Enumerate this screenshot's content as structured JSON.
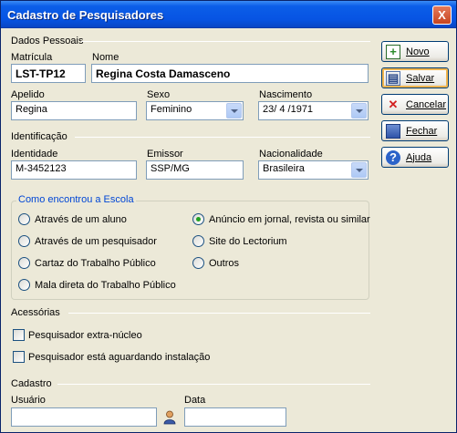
{
  "window": {
    "title": "Cadastro de Pesquisadores",
    "close_label": "X"
  },
  "sections": {
    "dados_pessoais": "Dados Pessoais",
    "identificacao": "Identificação",
    "acessorias": "Acessórias",
    "cadastro": "Cadastro"
  },
  "fields": {
    "matricula": {
      "label": "Matrícula",
      "value": "LST-TP12"
    },
    "nome": {
      "label": "Nome",
      "value": "Regina Costa Damasceno"
    },
    "apelido": {
      "label": "Apelido",
      "value": "Regina"
    },
    "sexo": {
      "label": "Sexo",
      "value": "Feminino"
    },
    "nascimento": {
      "label": "Nascimento",
      "value": "23/ 4 /1971"
    },
    "identidade": {
      "label": "Identidade",
      "value": "M-3452123"
    },
    "emissor": {
      "label": "Emissor",
      "value": "SSP/MG"
    },
    "nacionalidade": {
      "label": "Nacionalidade",
      "value": "Brasileira"
    },
    "usuario": {
      "label": "Usuário",
      "value": ""
    },
    "data": {
      "label": "Data",
      "value": ""
    }
  },
  "escola_group": {
    "legend": "Como encontrou a Escola",
    "options": [
      {
        "label": "Através de um aluno",
        "selected": false
      },
      {
        "label": "Através de um pesquisador",
        "selected": false
      },
      {
        "label": "Cartaz do Trabalho Público",
        "selected": false
      },
      {
        "label": "Mala direta do Trabalho Público",
        "selected": false
      },
      {
        "label": "Anúncio em jornal, revista ou similar",
        "selected": true
      },
      {
        "label": "Site do Lectorium",
        "selected": false
      },
      {
        "label": "Outros",
        "selected": false
      }
    ]
  },
  "acessorias_checks": [
    {
      "label": "Pesquisador extra-núcleo",
      "checked": false
    },
    {
      "label": "Pesquisador está aguardando instalação",
      "checked": false
    }
  ],
  "buttons": {
    "novo": {
      "label": "Novo",
      "icon": "new-document-icon"
    },
    "salvar": {
      "label": "Salvar",
      "icon": "save-icon"
    },
    "cancelar": {
      "label": "Cancelar",
      "icon": "cancel-x-icon"
    },
    "fechar": {
      "label": "Fechar",
      "icon": "close-door-icon"
    },
    "ajuda": {
      "label": "Ajuda",
      "icon": "help-icon"
    }
  },
  "colors": {
    "titlebar": "#0754e3",
    "window_bg": "#ece9d8",
    "group_legend": "#0046d5",
    "radio_selected": "#21a121"
  }
}
